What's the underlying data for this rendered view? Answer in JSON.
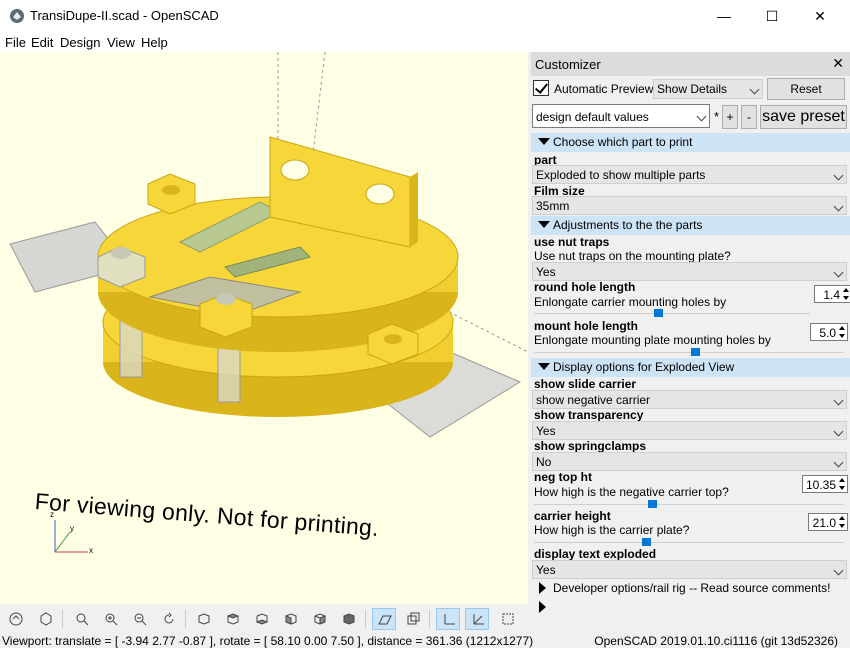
{
  "window": {
    "title": "TransiDupe-II.scad - OpenSCAD",
    "minimize": "—",
    "maximize": "☐",
    "close": "✕"
  },
  "menu": [
    "File",
    "Edit",
    "Design",
    "View",
    "Help"
  ],
  "viewport": {
    "overlay_text": "For viewing only.  Not for printing.",
    "axis_labels": [
      "z",
      "y",
      "x"
    ],
    "colors": {
      "background": "#ffffe5",
      "part": "#f7d639",
      "part_dark": "#d9b41a",
      "film": "#c8c8c8"
    }
  },
  "toolbar": {
    "icons": [
      "preview-icon",
      "render-icon",
      "view-all-icon",
      "zoom-in-icon",
      "zoom-out-icon",
      "reset-view-icon",
      "view-right-icon",
      "view-top-icon",
      "view-bottom-icon",
      "view-left-icon",
      "view-front-icon",
      "view-back-icon",
      "perspective-icon",
      "orthogonal-icon",
      "show-axes-icon",
      "show-scale-icon",
      "show-edges-icon"
    ]
  },
  "status": {
    "viewport": "Viewport: translate = [ -3.94 2.77 -0.87 ], rotate = [ 58.10 0.00 7.50 ], distance = 361.36 (1212x1277)",
    "version": "OpenSCAD 2019.01.10.ci1116 (git 13d52326)"
  },
  "customizer": {
    "title": "Customizer",
    "close": "✕",
    "auto_preview_label": "Automatic Preview",
    "details_value": "Show Details",
    "reset_label": "Reset",
    "preset_value": "design default values",
    "asterisk": "*",
    "plus": "+",
    "minus": "-",
    "save_preset": "save preset",
    "groups": {
      "g1": "Choose which part to print",
      "g2": "Adjustments to the the parts",
      "g3": "Display options for Exploded View",
      "g4": "Developer options/rail rig -- Read source comments!"
    },
    "params": {
      "part": {
        "name": "part",
        "value": "Exploded to show multiple parts"
      },
      "film": {
        "name": "Film size",
        "value": "35mm"
      },
      "nut": {
        "name": "use nut traps",
        "desc": "Use nut traps on the mounting plate?",
        "value": "Yes"
      },
      "round": {
        "name": "round hole length",
        "desc": "Enlongate carrier mounting holes by",
        "value": "1.4"
      },
      "mount": {
        "name": "mount hole length",
        "desc": "Enlongate mounting plate mounting holes by",
        "value": "5.0"
      },
      "slide": {
        "name": "show slide carrier",
        "value": "show negative carrier"
      },
      "transp": {
        "name": "show transparency",
        "value": "Yes"
      },
      "spring": {
        "name": "show springclamps",
        "value": "No"
      },
      "negtop": {
        "name": "neg top ht",
        "desc": "How high is the negative carrier top?",
        "value": "10.35"
      },
      "carrier": {
        "name": "carrier height",
        "desc": "How high is the carrier plate?",
        "value": "21.0"
      },
      "text": {
        "name": "display text exploded",
        "value": "Yes"
      }
    },
    "sliders": {
      "round": 0.45,
      "mount": 0.52,
      "negtop": 0.38,
      "carrier": 0.36
    }
  }
}
